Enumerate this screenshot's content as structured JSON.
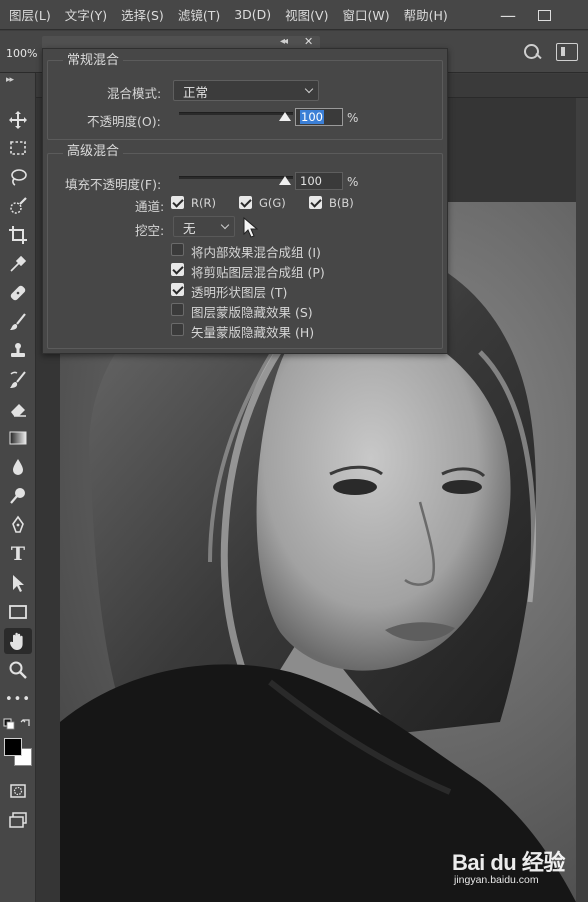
{
  "menu": [
    "图层(L)",
    "文字(Y)",
    "选择(S)",
    "滤镜(T)",
    "3D(D)",
    "视图(V)",
    "窗口(W)",
    "帮助(H)"
  ],
  "window": {
    "minimize": "—"
  },
  "options_bar": {
    "zoom": "100%"
  },
  "blending": {
    "general_title": "常规混合",
    "blend_mode_label": "混合模式:",
    "blend_mode_value": "正常",
    "opacity_label": "不透明度(O):",
    "opacity_value": "100",
    "opacity_unit": "%",
    "advanced_title": "高级混合",
    "fill_opacity_label": "填充不透明度(F):",
    "fill_opacity_value": "100",
    "fill_opacity_unit": "%",
    "channels_label": "通道:",
    "channels": [
      {
        "label": "R(R)",
        "checked": true
      },
      {
        "label": "G(G)",
        "checked": true
      },
      {
        "label": "B(B)",
        "checked": true
      }
    ],
    "knockout_label": "挖空:",
    "knockout_value": "无",
    "options": [
      {
        "label": "将内部效果混合成组 (I)",
        "checked": false
      },
      {
        "label": "将剪贴图层混合成组 (P)",
        "checked": true
      },
      {
        "label": "透明形状图层 (T)",
        "checked": true
      },
      {
        "label": "图层蒙版隐藏效果 (S)",
        "checked": false
      },
      {
        "label": "矢量蒙版隐藏效果 (H)",
        "checked": false
      }
    ]
  },
  "watermark": {
    "logo": "Bai du 经验",
    "url": "jingyan.baidu.com"
  }
}
